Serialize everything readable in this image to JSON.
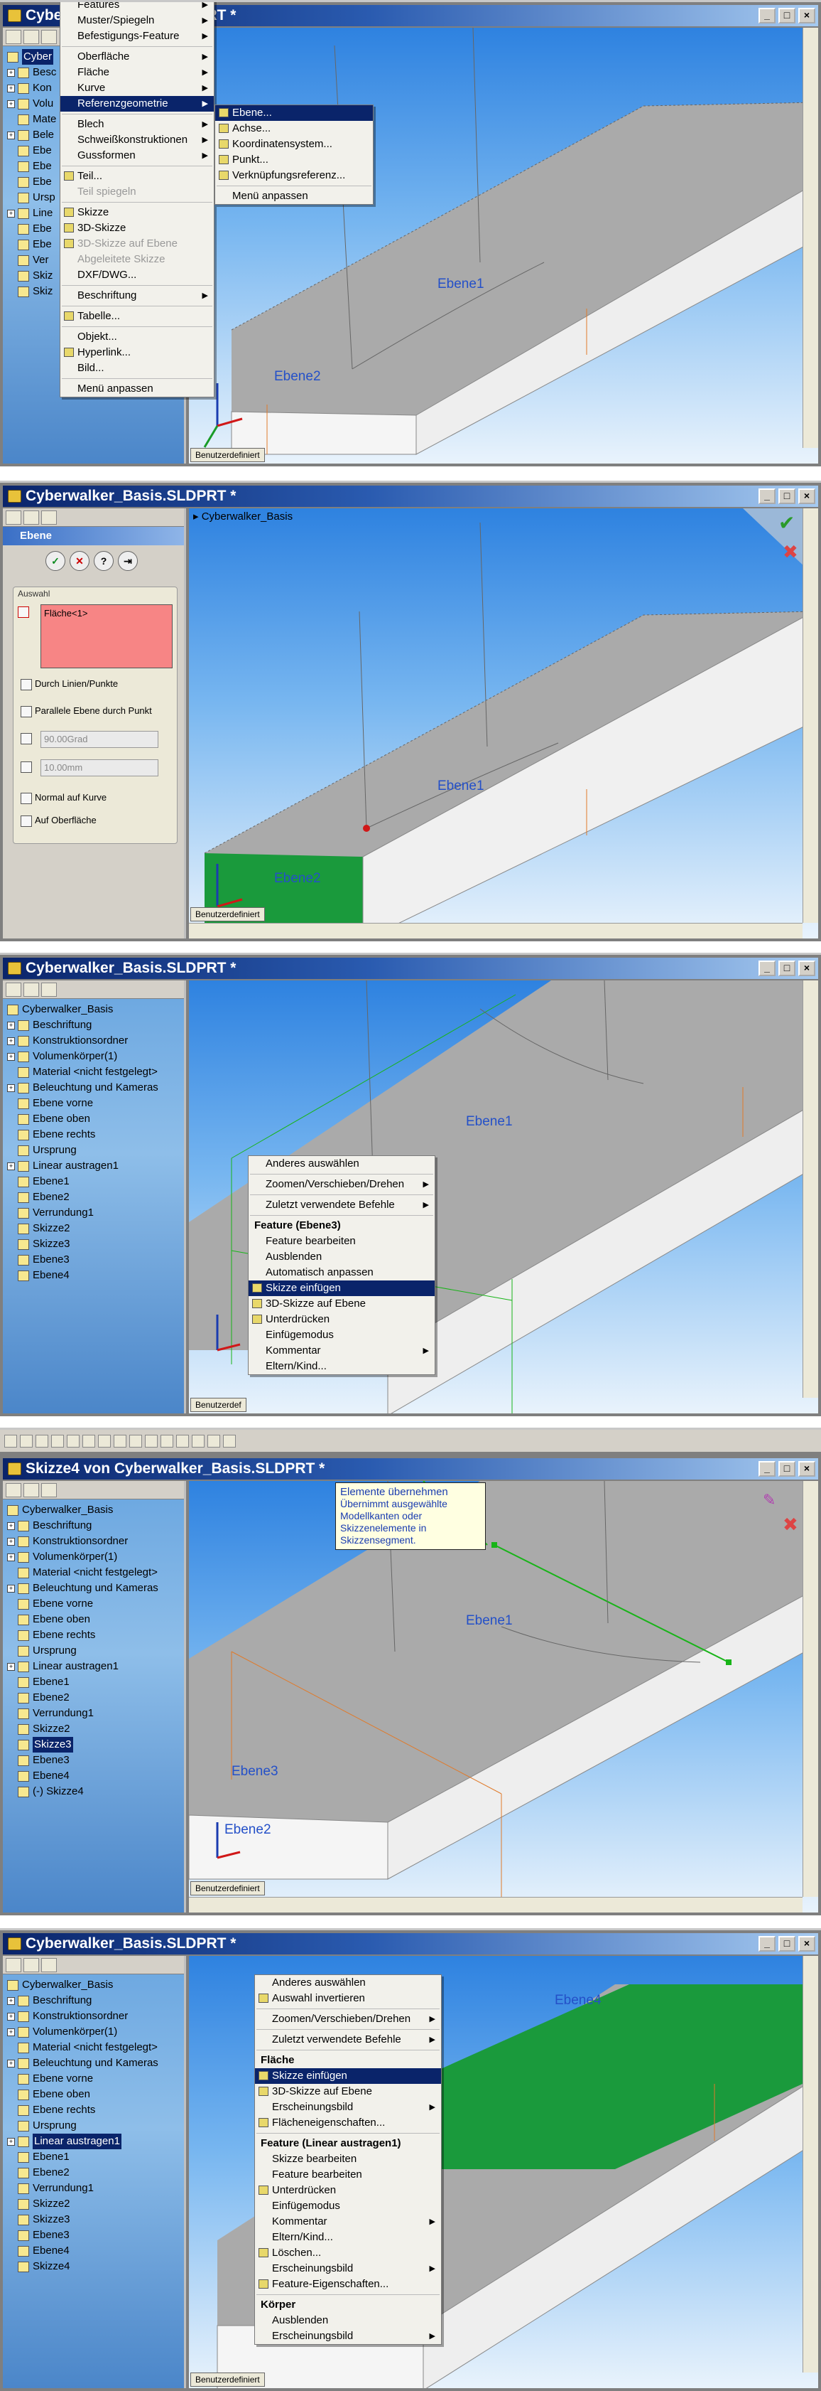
{
  "s1": {
    "title": "Cyberwalker_Basis.SLDPRT *",
    "tree_partial": [
      "Cyber",
      "Besc",
      "Kon",
      "Volu",
      "Mate",
      "Bele",
      "Ebe",
      "Ebe",
      "Ebe",
      "Ursp",
      "Line",
      "Ebe",
      "Ebe",
      "Ver",
      "Skiz",
      "Skiz"
    ],
    "menu": [
      "Features",
      "Muster/Spiegeln",
      "Befestigungs-Feature",
      "Oberfläche",
      "Fläche",
      "Kurve",
      "Referenzgeometrie",
      "Blech",
      "Schweißkonstruktionen",
      "Gussformen",
      "Teil...",
      "Teil spiegeln",
      "Skizze",
      "3D-Skizze",
      "3D-Skizze auf Ebene",
      "Abgeleitete Skizze",
      "DXF/DWG...",
      "Beschriftung",
      "Tabelle...",
      "Objekt...",
      "Hyperlink...",
      "Bild...",
      "Menü anpassen"
    ],
    "submenu": [
      "Ebene...",
      "Achse...",
      "Koordinatensystem...",
      "Punkt...",
      "Verknüpfungsreferenz...",
      "Menü anpassen"
    ],
    "labels": {
      "ebene1": "Ebene1",
      "ebene2": "Ebene2"
    },
    "status": "Benutzerdefiniert"
  },
  "s2": {
    "title": "Cyberwalker_Basis.SLDPRT *",
    "pm_title": "Ebene",
    "group_label": "Auswahl",
    "selection": "Fläche<1>",
    "options": [
      "Durch Linien/Punkte",
      "Parallele Ebene durch Punkt",
      "Normal auf Kurve",
      "Auf Oberfläche"
    ],
    "angle": "90.00Grad",
    "distance": "10.00mm",
    "root": "Cyberwalker_Basis",
    "labels": {
      "ebene1": "Ebene1",
      "ebene2": "Ebene2"
    },
    "status": "Benutzerdefiniert"
  },
  "tree_full": [
    "Cyberwalker_Basis",
    "Beschriftung",
    "Konstruktionsordner",
    "Volumenkörper(1)",
    "Material <nicht festgelegt>",
    "Beleuchtung und Kameras",
    "Ebene vorne",
    "Ebene oben",
    "Ebene rechts",
    "Ursprung",
    "Linear austragen1",
    "Ebene1",
    "Ebene2",
    "Verrundung1",
    "Skizze2",
    "Skizze3",
    "Ebene3",
    "Ebene4"
  ],
  "s3": {
    "title": "Cyberwalker_Basis.SLDPRT *",
    "menu_top": [
      "Anderes auswählen",
      "Zoomen/Verschieben/Drehen",
      "Zuletzt verwendete Befehle"
    ],
    "header": "Feature (Ebene3)",
    "menu_feature": [
      "Feature bearbeiten",
      "Ausblenden",
      "Automatisch anpassen",
      "Skizze einfügen",
      "3D-Skizze auf Ebene",
      "Unterdrücken",
      "Einfügemodus",
      "Kommentar",
      "Eltern/Kind..."
    ],
    "labels": {
      "ebene1": "Ebene1"
    },
    "status": "Benutzerdef"
  },
  "s4": {
    "title": "Skizze4 von Cyberwalker_Basis.SLDPRT *",
    "tooltip_title": "Elemente übernehmen",
    "tooltip_body": "Übernimmt ausgewählte Modellkanten oder Skizzenelemente in Skizzensegment.",
    "extra_tree": "(-) Skizze4",
    "labels": {
      "ebene1": "Ebene1",
      "ebene3": "Ebene3",
      "ebene2": "Ebene2"
    },
    "status": "Benutzerdefiniert"
  },
  "s5": {
    "title": "Cyberwalker_Basis.SLDPRT *",
    "tree_last": "Skizze4",
    "menu_top": [
      "Anderes auswählen",
      "Auswahl invertieren",
      "Zoomen/Verschieben/Drehen",
      "Zuletzt verwendete Befehle"
    ],
    "h_face": "Fläche",
    "menu_face": [
      "Skizze einfügen",
      "3D-Skizze auf Ebene",
      "Erscheinungsbild",
      "Flächeneigenschaften..."
    ],
    "h_feat": "Feature (Linear austragen1)",
    "menu_feat": [
      "Skizze bearbeiten",
      "Feature bearbeiten",
      "Unterdrücken",
      "Einfügemodus",
      "Kommentar",
      "Eltern/Kind...",
      "Löschen...",
      "Erscheinungsbild",
      "Feature-Eigenschaften..."
    ],
    "h_body": "Körper",
    "menu_body": [
      "Ausblenden",
      "Erscheinungsbild"
    ],
    "labels": {
      "ebene4": "Ebene4"
    },
    "status": "Benutzerdefiniert"
  },
  "colors": {
    "title_bar": "#0a246a",
    "viewport_top": "#2e82e0",
    "face_green": "#1a9a3c",
    "selection_red": "#f78585"
  }
}
